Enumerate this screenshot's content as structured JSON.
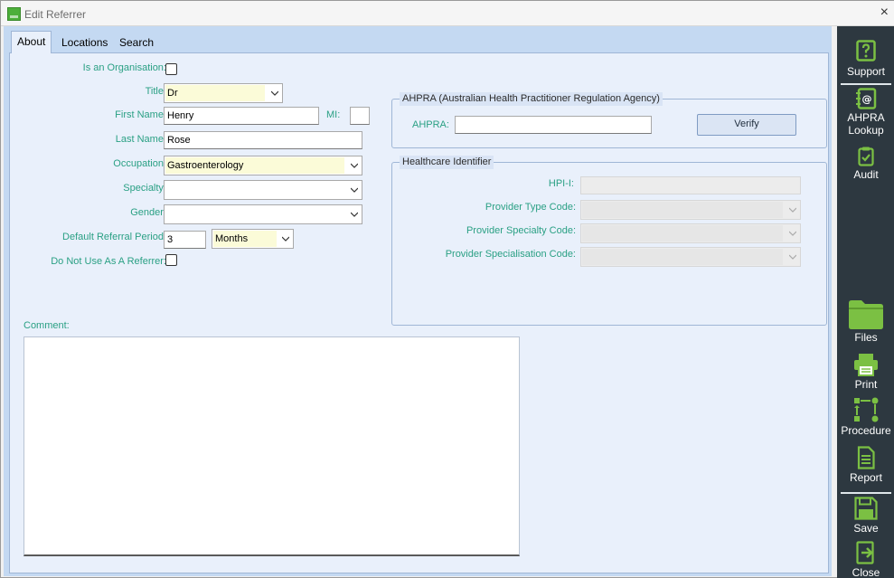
{
  "window": {
    "title": "Edit Referrer",
    "close_label": "×"
  },
  "tabs": [
    {
      "label": "About"
    },
    {
      "label": "Locations"
    },
    {
      "label": "Search"
    }
  ],
  "about": {
    "is_org_label": "Is an Organisation:",
    "title_label": "Title:",
    "title_value": "Dr",
    "first_name_label": "First Name:",
    "first_name_value": "Henry",
    "mi_label": "MI:",
    "mi_value": "",
    "last_name_label": "Last Name:",
    "last_name_value": "Rose",
    "occupation_label": "Occupation:",
    "occupation_value": "Gastroenterology",
    "specialty_label": "Specialty:",
    "specialty_value": "",
    "gender_label": "Gender:",
    "gender_value": "",
    "referral_period_label": "Default Referral Period:",
    "referral_period_value": "3",
    "referral_unit_value": "Months",
    "do_not_use_label": "Do Not Use As A Referrer:",
    "comment_label": "Comment:",
    "comment_value": ""
  },
  "ahpra": {
    "group_title": "AHPRA (Australian Health Practitioner Regulation Agency)",
    "label": "AHPRA:",
    "value": "",
    "verify_label": "Verify"
  },
  "healthcare": {
    "group_title": "Healthcare Identifier",
    "hpii_label": "HPI-I:",
    "provider_type_label": "Provider Type Code:",
    "provider_specialty_label": "Provider Specialty Code:",
    "provider_specialisation_label": "Provider Specialisation Code:"
  },
  "sidebar": {
    "support": "Support",
    "ahpra_lookup_1": "AHPRA",
    "ahpra_lookup_2": "Lookup",
    "audit": "Audit",
    "files": "Files",
    "print": "Print",
    "procedure": "Procedure",
    "report": "Report",
    "save": "Save",
    "close": "Close"
  },
  "colors": {
    "accent_green": "#7bc043",
    "label_teal": "#2aa084",
    "sidebar_bg": "#2d3840",
    "panel_bg": "#e9f0fb"
  }
}
